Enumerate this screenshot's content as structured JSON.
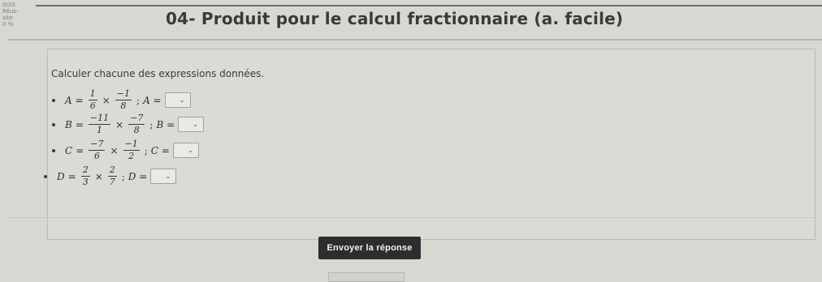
{
  "header": {
    "score": "0/10",
    "success_label_1": "Réus-",
    "success_label_2": "site",
    "success_percent": "0 %",
    "title": "04- Produit pour le calcul fractionnaire (a. facile)"
  },
  "exercise": {
    "prompt": "Calculer chacune des expressions données.",
    "items": [
      {
        "var": "A",
        "f1_num": "1",
        "f1_den": "6",
        "f2_num": "−1",
        "f2_den": "8",
        "answer_label": "A ="
      },
      {
        "var": "B",
        "f1_num": "−11",
        "f1_den": "1",
        "f2_num": "−7",
        "f2_den": "8",
        "answer_label": "B ="
      },
      {
        "var": "C",
        "f1_num": "−7",
        "f1_den": "6",
        "f2_num": "−1",
        "f2_den": "2",
        "answer_label": "C ="
      },
      {
        "var": "D",
        "f1_num": "2",
        "f1_den": "3",
        "f2_num": "2",
        "f2_den": "7",
        "answer_label": "D ="
      }
    ]
  },
  "actions": {
    "submit_label": "Envoyer la réponse"
  },
  "symbols": {
    "equals": "=",
    "times": "×",
    "semicolon": ";",
    "chevron": "⌄"
  },
  "colors": {
    "background": "#d6d8d2",
    "button_bg": "#2c2d2f",
    "button_text": "#f1f1f1"
  }
}
